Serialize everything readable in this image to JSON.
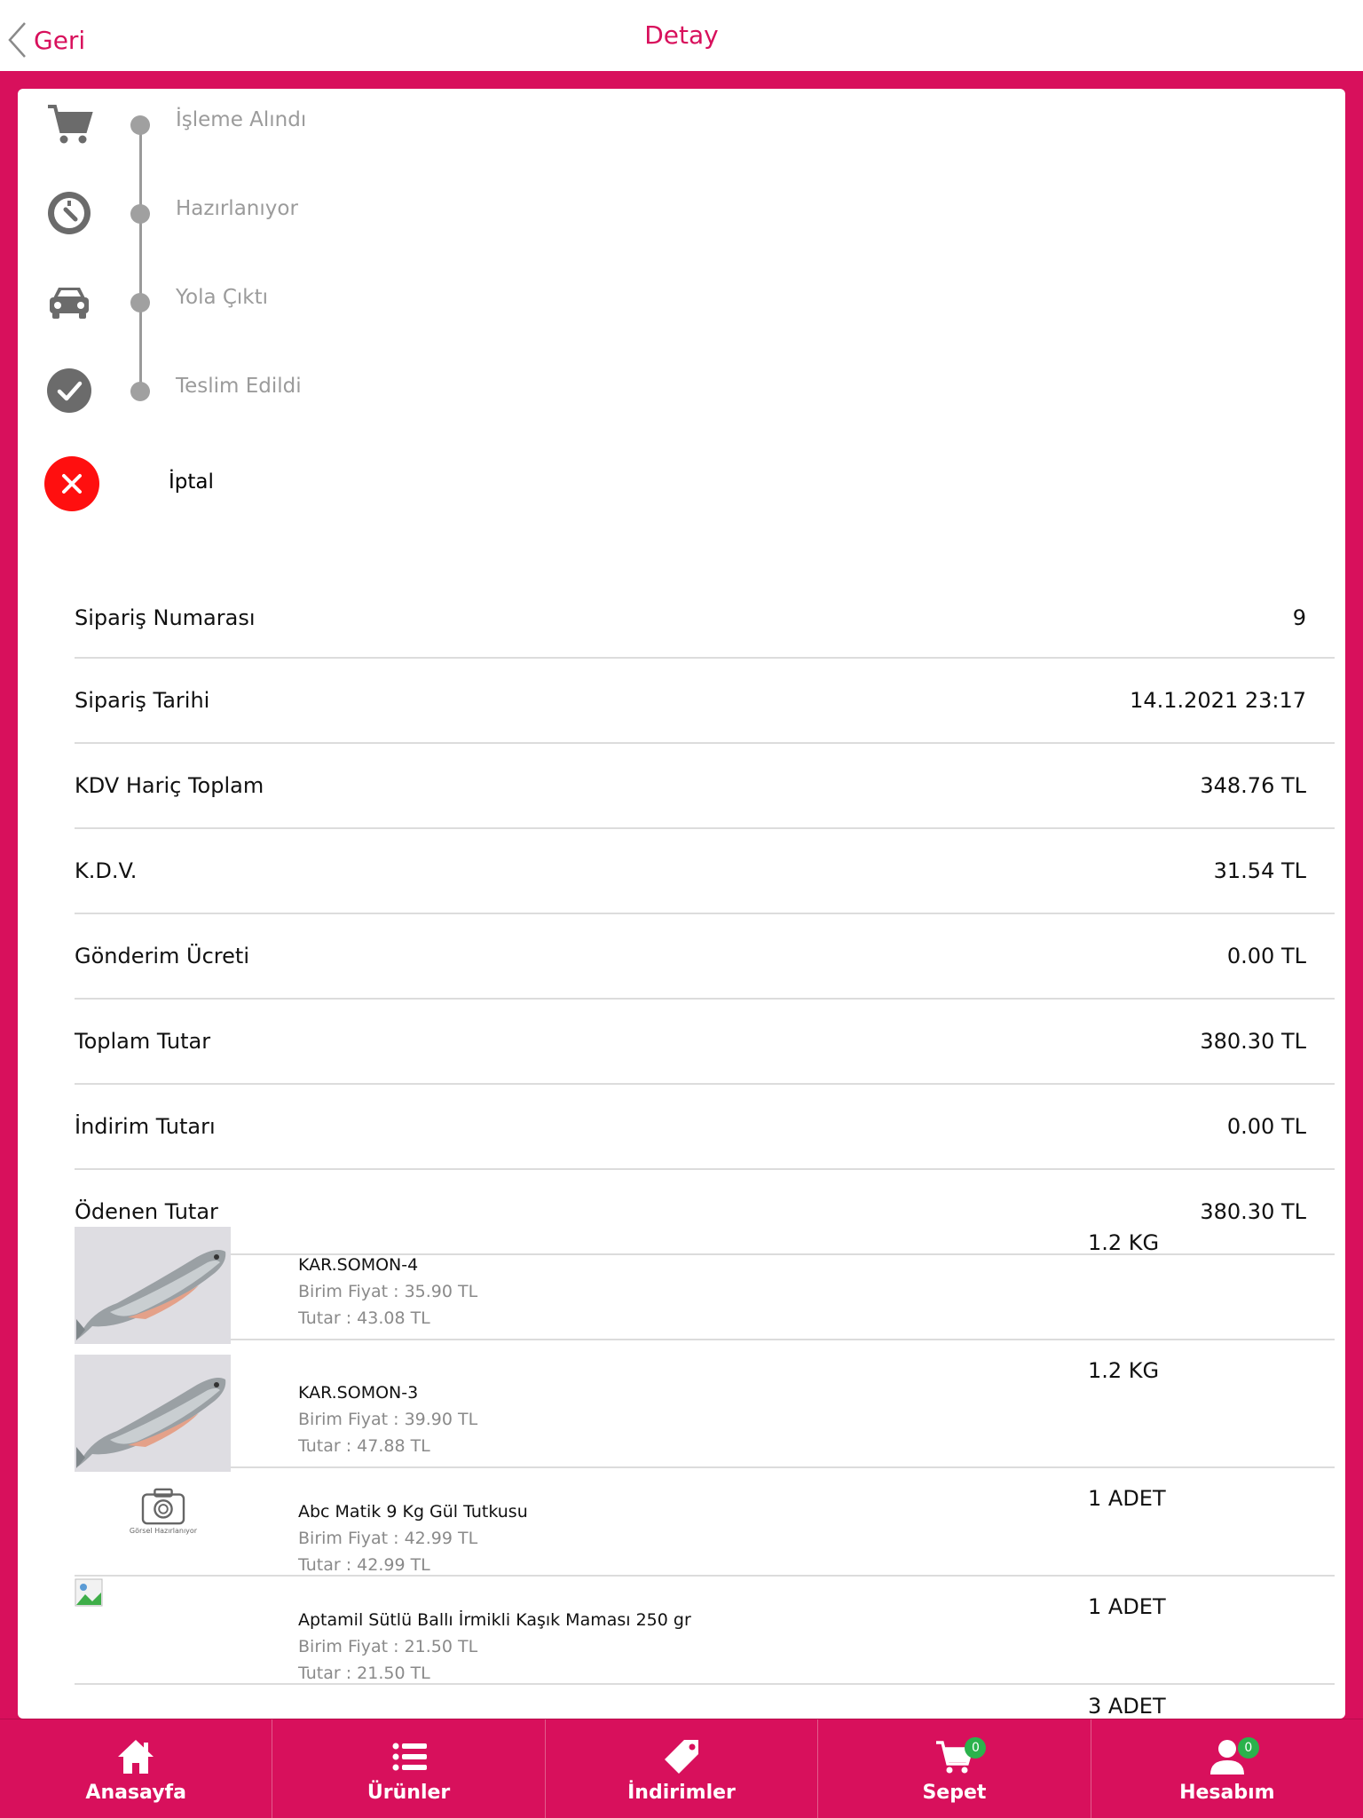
{
  "nav": {
    "back_label": "Geri",
    "title": "Detay"
  },
  "timeline": [
    {
      "label": "İşleme Alındı",
      "icon": "cart-icon"
    },
    {
      "label": "Hazırlanıyor",
      "icon": "timer-icon"
    },
    {
      "label": "Yola Çıktı",
      "icon": "car-icon"
    },
    {
      "label": "Teslim Edildi",
      "icon": "check-circle-icon"
    }
  ],
  "cancel": {
    "label": "İptal",
    "icon": "close-circle-icon",
    "color": "#ff0f0f"
  },
  "summary": [
    {
      "label": "Sipariş Numarası",
      "value": "9"
    },
    {
      "label": "Sipariş Tarihi",
      "value": "14.1.2021 23:17"
    },
    {
      "label": "KDV Hariç Toplam",
      "value": "348.76 TL"
    },
    {
      "label": "K.D.V.",
      "value": "31.54 TL"
    },
    {
      "label": "Gönderim Ücreti",
      "value": "0.00 TL"
    },
    {
      "label": "Toplam Tutar",
      "value": "380.30 TL"
    },
    {
      "label": "İndirim Tutarı",
      "value": "0.00 TL"
    },
    {
      "label": "Ödenen Tutar",
      "value": "380.30 TL"
    }
  ],
  "items": [
    {
      "name": "KAR.SOMON-4",
      "unit_price": "Birim Fiyat : 35.90 TL",
      "total": "Tutar : 43.08 TL",
      "qty": "1.2  KG"
    },
    {
      "name": "KAR.SOMON-3",
      "unit_price": "Birim Fiyat : 39.90 TL",
      "total": "Tutar : 47.88 TL",
      "qty": "1.2  KG"
    },
    {
      "name": "Abc Matik 9 Kg Gül Tutkusu",
      "unit_price": "Birim Fiyat : 42.99 TL",
      "total": "Tutar : 42.99 TL",
      "qty": "1  ADET",
      "placeholder_text": "Görsel Hazırlanıyor"
    },
    {
      "name": "Aptamil Sütlü Ballı İrmikli Kaşık Maması 250 gr",
      "unit_price": "Birim Fiyat : 21.50 TL",
      "total": "Tutar : 21.50 TL",
      "qty": "1  ADET"
    },
    {
      "qty": "3  ADET"
    }
  ],
  "tabs": [
    {
      "label": "Anasayfa",
      "icon": "home-icon"
    },
    {
      "label": "Ürünler",
      "icon": "list-icon"
    },
    {
      "label": "İndirimler",
      "icon": "tag-icon"
    },
    {
      "label": "Sepet",
      "icon": "cart-icon",
      "badge": "0"
    },
    {
      "label": "Hesabım",
      "icon": "user-icon",
      "badge": "0"
    }
  ],
  "colors": {
    "brand": "#d8105c",
    "badge": "#2bb24c",
    "step_gray": "#9b9b9b"
  }
}
